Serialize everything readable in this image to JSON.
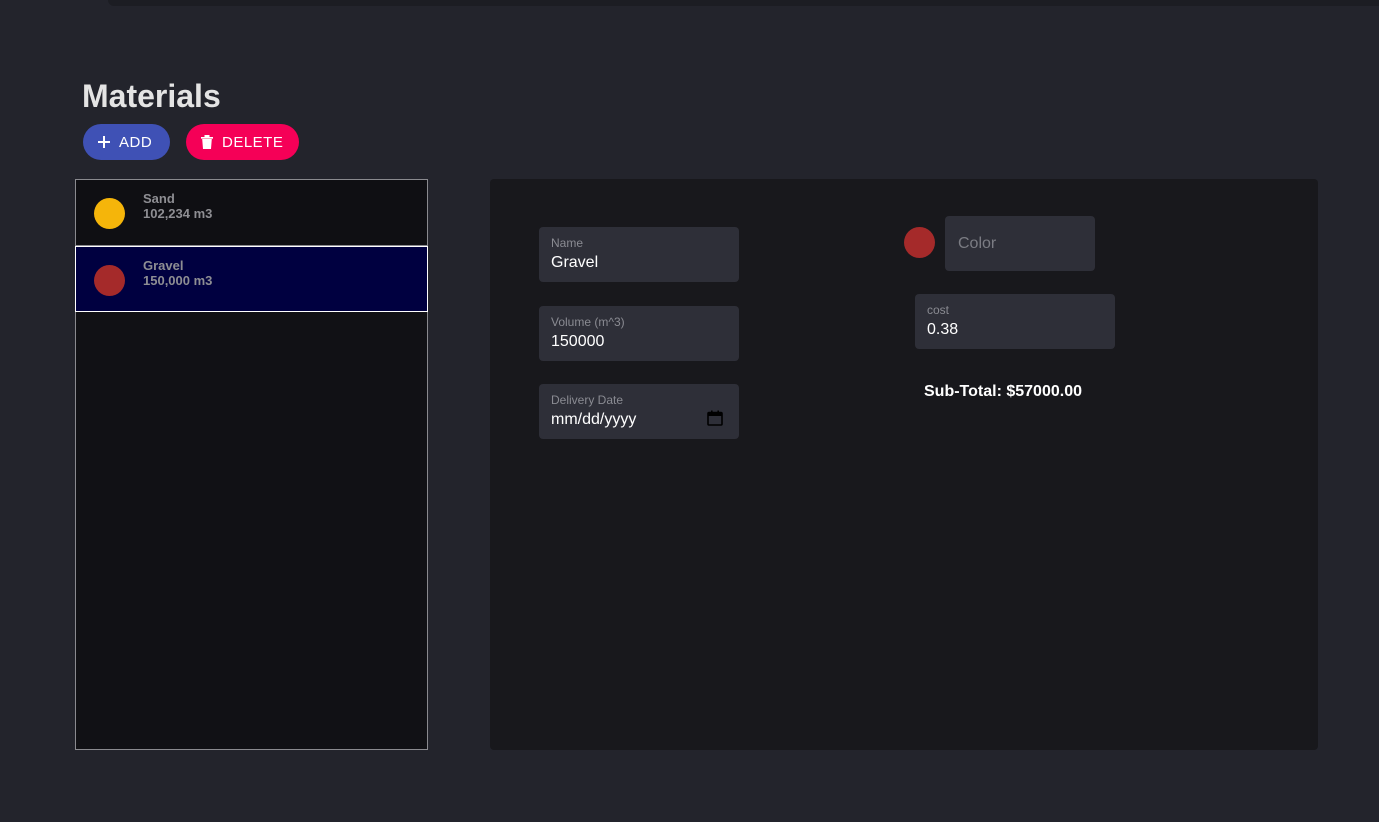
{
  "page": {
    "title": "Materials"
  },
  "toolbar": {
    "add_label": "ADD",
    "delete_label": "DELETE"
  },
  "materials": [
    {
      "name": "Sand",
      "volume": "102,234 m3",
      "color": "#f5b50a",
      "selected": false
    },
    {
      "name": "Gravel",
      "volume": "150,000 m3",
      "color": "#a52a2a",
      "selected": true
    }
  ],
  "form": {
    "name_label": "Name",
    "name_value": "Gravel",
    "volume_label": "Volume (m^3)",
    "volume_value": "150000",
    "date_label": "Delivery Date",
    "date_value": "mm/dd/yyyy",
    "color_placeholder": "Color",
    "color_value": "#a52a2a",
    "cost_label": "cost",
    "cost_value": "0.38",
    "subtotal": "Sub-Total: $57000.00"
  },
  "colors": {
    "add_button": "#3f51b5",
    "delete_button": "#f50057",
    "selected_row": "#000040"
  },
  "icons": {
    "add": "plus-icon",
    "delete": "trash-icon",
    "date": "calendar-icon"
  }
}
